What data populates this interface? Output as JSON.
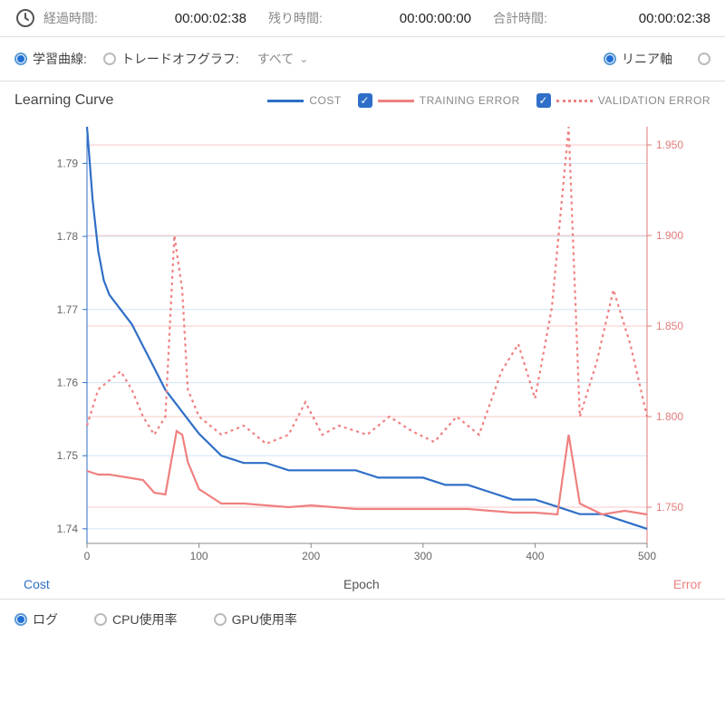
{
  "timebar": {
    "elapsed_label": "経過時間:",
    "elapsed_value": "00:00:02:38",
    "remaining_label": "残り時間:",
    "remaining_value": "00:00:00:00",
    "total_label": "合計時間:",
    "total_value": "00:00:02:38"
  },
  "tabs": {
    "learning_curve": "学習曲線:",
    "tradeoff_graph": "トレードオフグラフ:",
    "filter_all": "すべて",
    "linear_axis": "リニア軸"
  },
  "chart": {
    "title": "Learning Curve",
    "legend_cost": "COST",
    "legend_training": "TRAINING ERROR",
    "legend_validation": "VALIDATION ERROR",
    "xlabel": "Epoch",
    "ylabel_left": "Cost",
    "ylabel_right": "Error"
  },
  "bottom": {
    "log": "ログ",
    "cpu": "CPU使用率",
    "gpu": "GPU使用率"
  },
  "colors": {
    "cost": "#2f6fc7",
    "train": "#f08080",
    "valid": "#f08080"
  },
  "chart_data": {
    "type": "line",
    "title": "Learning Curve",
    "xlabel": "Epoch",
    "xlim": [
      0,
      500
    ],
    "xticks": [
      0,
      100,
      200,
      300,
      400,
      500
    ],
    "y_left_label": "Cost",
    "y_left_lim": [
      1.738,
      1.795
    ],
    "y_left_ticks": [
      1.74,
      1.75,
      1.76,
      1.77,
      1.78,
      1.79
    ],
    "y_right_label": "Error",
    "y_right_lim": [
      1.73,
      1.96
    ],
    "y_right_ticks": [
      1.75,
      1.8,
      1.85,
      1.9,
      1.95
    ],
    "series": [
      {
        "name": "COST",
        "axis": "left",
        "style": "solid",
        "color": "#2f6fc7",
        "x": [
          0,
          5,
          10,
          15,
          20,
          25,
          30,
          40,
          50,
          60,
          70,
          80,
          90,
          100,
          120,
          140,
          160,
          180,
          200,
          220,
          240,
          260,
          280,
          300,
          320,
          340,
          360,
          380,
          400,
          420,
          440,
          460,
          480,
          500
        ],
        "y": [
          1.795,
          1.785,
          1.778,
          1.774,
          1.772,
          1.771,
          1.77,
          1.768,
          1.765,
          1.762,
          1.759,
          1.757,
          1.755,
          1.753,
          1.75,
          1.749,
          1.749,
          1.748,
          1.748,
          1.748,
          1.748,
          1.747,
          1.747,
          1.747,
          1.746,
          1.746,
          1.745,
          1.744,
          1.744,
          1.743,
          1.742,
          1.742,
          1.741,
          1.74
        ]
      },
      {
        "name": "TRAINING ERROR",
        "axis": "right",
        "style": "solid",
        "color": "#f08080",
        "x": [
          0,
          10,
          20,
          30,
          40,
          50,
          60,
          70,
          80,
          85,
          90,
          100,
          120,
          140,
          160,
          180,
          200,
          220,
          240,
          260,
          280,
          300,
          320,
          340,
          360,
          380,
          400,
          420,
          430,
          440,
          460,
          480,
          500
        ],
        "y": [
          1.77,
          1.768,
          1.768,
          1.767,
          1.766,
          1.765,
          1.758,
          1.757,
          1.792,
          1.79,
          1.775,
          1.76,
          1.752,
          1.752,
          1.751,
          1.75,
          1.751,
          1.75,
          1.749,
          1.749,
          1.749,
          1.749,
          1.749,
          1.749,
          1.748,
          1.747,
          1.747,
          1.746,
          1.79,
          1.752,
          1.746,
          1.748,
          1.746
        ]
      },
      {
        "name": "VALIDATION ERROR",
        "axis": "right",
        "style": "dotted",
        "color": "#f08080",
        "x": [
          0,
          10,
          20,
          30,
          40,
          50,
          60,
          70,
          78,
          85,
          90,
          100,
          120,
          140,
          160,
          180,
          195,
          210,
          225,
          250,
          270,
          290,
          310,
          330,
          350,
          370,
          385,
          400,
          415,
          430,
          440,
          455,
          470,
          485,
          500
        ],
        "y": [
          1.795,
          1.815,
          1.82,
          1.825,
          1.815,
          1.8,
          1.79,
          1.8,
          1.9,
          1.87,
          1.815,
          1.8,
          1.79,
          1.795,
          1.785,
          1.79,
          1.808,
          1.79,
          1.795,
          1.79,
          1.8,
          1.792,
          1.786,
          1.8,
          1.79,
          1.825,
          1.84,
          1.81,
          1.86,
          1.96,
          1.8,
          1.83,
          1.87,
          1.84,
          1.8
        ]
      }
    ]
  }
}
